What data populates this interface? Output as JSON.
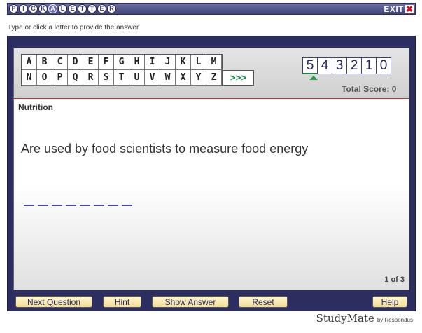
{
  "titlebar": {
    "logo_letters": [
      "P",
      "I",
      "C",
      "K",
      "A",
      "L",
      "E",
      "T",
      "T",
      "E",
      "R"
    ],
    "exit_label": "EXIT",
    "exit_icon": "✖"
  },
  "instructions": "Type or click a letter to provide the answer.",
  "letters": [
    "A",
    "B",
    "C",
    "D",
    "E",
    "F",
    "G",
    "H",
    "I",
    "J",
    "K",
    "L",
    "M",
    "N",
    "O",
    "P",
    "Q",
    "R",
    "S",
    "T",
    "U",
    "V",
    "W",
    "X",
    "Y",
    "Z"
  ],
  "more_label": ">>>",
  "score": {
    "values": [
      "5",
      "4",
      "3",
      "2",
      "1",
      "0"
    ],
    "current_index": 0,
    "total_label": "Total Score: 0"
  },
  "question": {
    "category": "Nutrition",
    "text": "Are used by food scientists to measure food energy",
    "blank_count": 8,
    "progress": "1 of 3"
  },
  "buttons": {
    "next": "Next Question",
    "hint": "Hint",
    "show": "Show Answer",
    "reset": "Reset",
    "help": "Help"
  },
  "brand": {
    "name": "StudyMate",
    "by": "by Respondus"
  },
  "colors": {
    "frame": "#2c2e60",
    "accent_green": "#0b8a48",
    "button_bg": "#f2dd97"
  }
}
